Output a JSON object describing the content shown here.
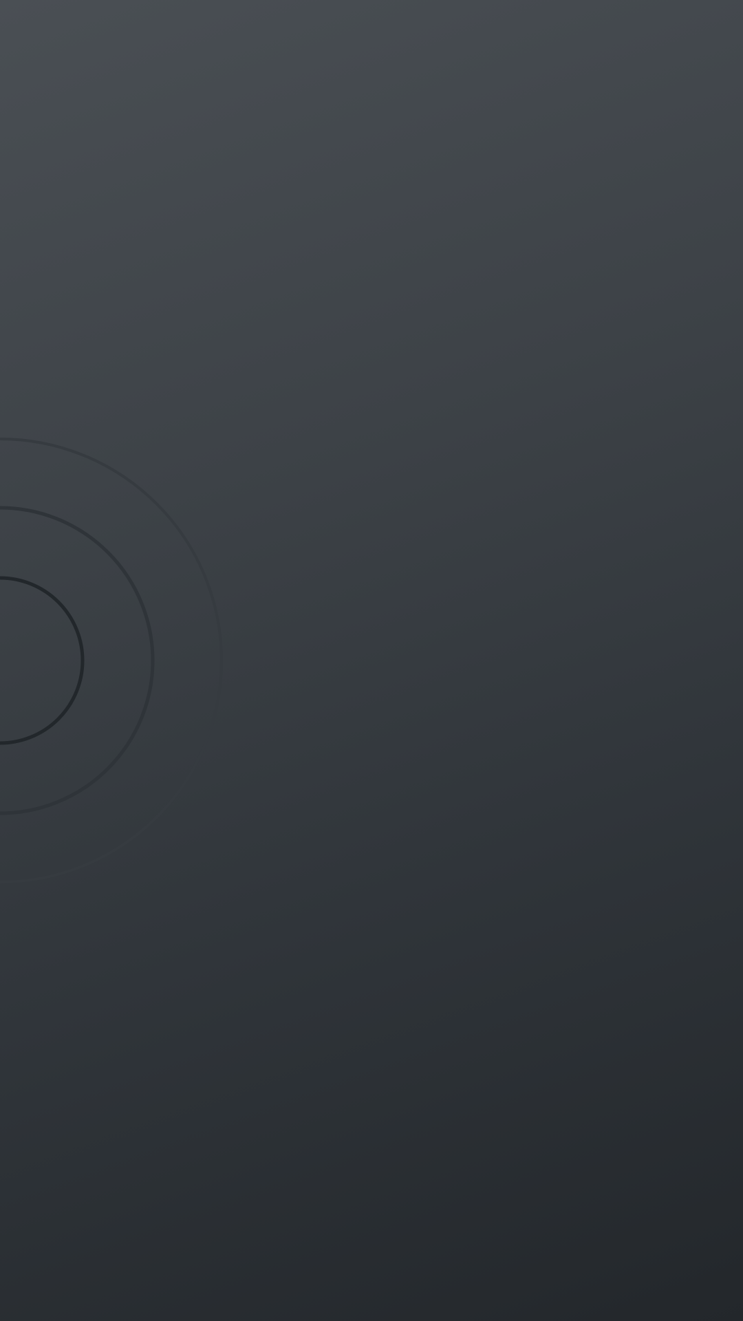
{
  "screen": {
    "background_top_color": "#4a4f54",
    "background_bottom_color": "#23272b",
    "ring_colors": [
      "#2b3035",
      "#2f3439",
      "#363b40"
    ],
    "icon": "concentric-rings-graphic"
  }
}
